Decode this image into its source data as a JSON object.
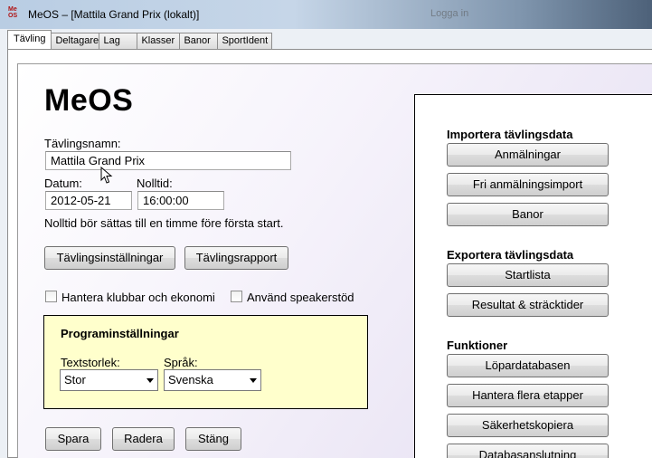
{
  "window": {
    "title": "MeOS – [Mattila Grand Prix (lokalt)]",
    "icon_text_top": "Me",
    "icon_text_bottom": "OS",
    "background_text": "Logga in"
  },
  "tabs": [
    {
      "label": "Tävling",
      "active": true
    },
    {
      "label": "Deltagare",
      "active": false
    },
    {
      "label": "Lag",
      "active": false
    },
    {
      "label": "Klasser",
      "active": false
    },
    {
      "label": "Banor",
      "active": false
    },
    {
      "label": "SportIdent",
      "active": false
    }
  ],
  "main": {
    "heading": "MeOS",
    "competition_name_label": "Tävlingsnamn:",
    "competition_name_value": "Mattila Grand Prix",
    "date_label": "Datum:",
    "date_value": "2012-05-21",
    "zero_time_label": "Nolltid:",
    "zero_time_value": "16:00:00",
    "zero_time_hint": "Nolltid bör sättas till en timme före första start.",
    "settings_button": "Tävlingsinställningar",
    "report_button": "Tävlingsrapport",
    "clubs_checkbox_label": "Hantera klubbar och ekonomi",
    "clubs_checked": false,
    "speaker_checkbox_label": "Använd speakerstöd",
    "speaker_checked": false
  },
  "program_settings": {
    "title": "Programinställningar",
    "text_size_label": "Textstorlek:",
    "text_size_value": "Stor",
    "language_label": "Språk:",
    "language_value": "Svenska"
  },
  "actions": {
    "save": "Spara",
    "delete": "Radera",
    "close": "Stäng"
  },
  "right_panel": {
    "import_title": "Importera tävlingsdata",
    "import_buttons": [
      "Anmälningar",
      "Fri anmälningsimport",
      "Banor"
    ],
    "export_title": "Exportera tävlingsdata",
    "export_buttons": [
      "Startlista",
      "Resultat & sträcktider"
    ],
    "functions_title": "Funktioner",
    "function_buttons": [
      "Löpardatabasen",
      "Hantera flera etapper",
      "Säkerhetskopiera",
      "Databasanslutning"
    ]
  },
  "colors": {
    "settings_box_bg": "#ffffcc",
    "title_app_icon": "#b01010"
  }
}
